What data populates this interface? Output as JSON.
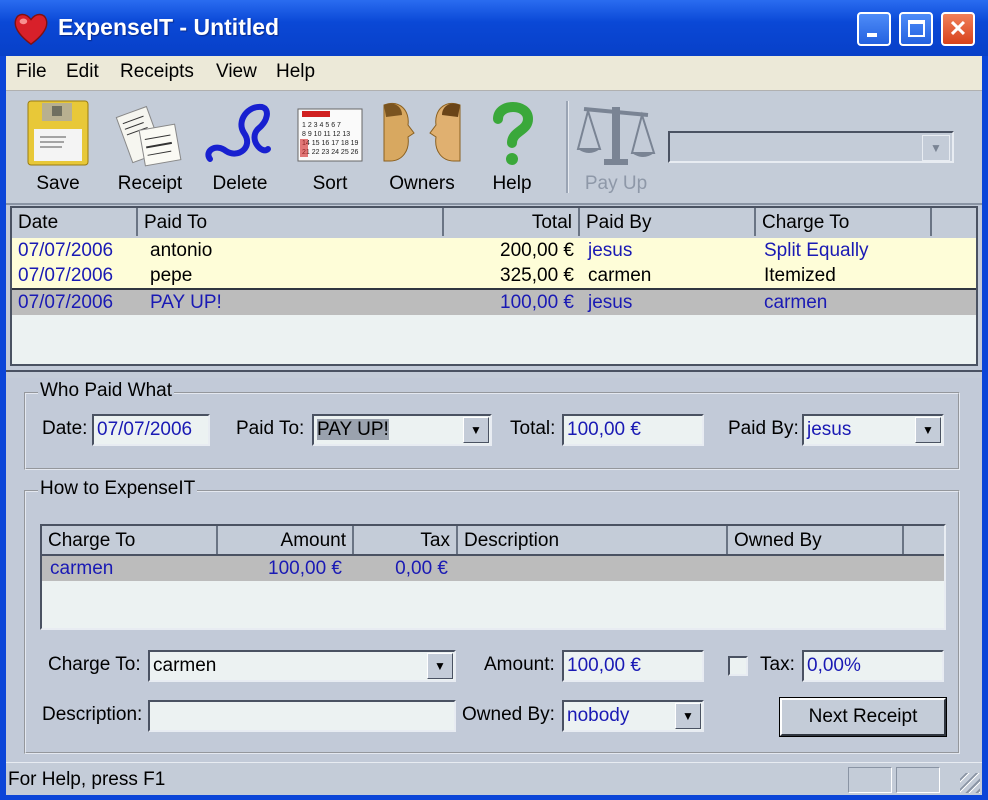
{
  "window": {
    "title": "ExpenseIT - Untitled",
    "icon": "heart-icon",
    "controls": [
      "minimize",
      "maximize",
      "close"
    ]
  },
  "menu": {
    "items": [
      "File",
      "Edit",
      "Receipts",
      "View",
      "Help"
    ]
  },
  "toolbar": {
    "buttons": [
      {
        "label": "Save",
        "icon": "floppy-disk-icon"
      },
      {
        "label": "Receipt",
        "icon": "receipt-icon"
      },
      {
        "label": "Delete",
        "icon": "scribble-delete-icon"
      },
      {
        "label": "Sort",
        "icon": "calendar-icon"
      },
      {
        "label": "Owners",
        "icon": "faces-icon"
      },
      {
        "label": "Help",
        "icon": "question-mark-icon"
      },
      {
        "label": "Pay Up",
        "icon": "balance-scale-icon",
        "disabled": true
      }
    ],
    "payup_combo_value": ""
  },
  "receipts": {
    "columns": [
      "Date",
      "Paid To",
      "Total",
      "Paid By",
      "Charge To"
    ],
    "rows": [
      {
        "date": "07/07/2006",
        "paid_to": "antonio",
        "total": "200,00 €",
        "paid_by": "jesus",
        "charge_to": "Split Equally"
      },
      {
        "date": "07/07/2006",
        "paid_to": "pepe",
        "total": "325,00 €",
        "paid_by": "carmen",
        "charge_to": "Itemized"
      },
      {
        "date": "07/07/2006",
        "paid_to": "PAY UP!",
        "total": "100,00 €",
        "paid_by": "jesus",
        "charge_to": "carmen",
        "selected": true
      }
    ]
  },
  "who_paid": {
    "legend": "Who Paid What",
    "date_label": "Date:",
    "date_value": "07/07/2006",
    "paid_to_label": "Paid To:",
    "paid_to_value": "PAY UP!",
    "total_label": "Total:",
    "total_value": "100,00 €",
    "paid_by_label": "Paid By:",
    "paid_by_value": "jesus"
  },
  "how_to": {
    "legend": "How to ExpenseIT",
    "columns": [
      "Charge To",
      "Amount",
      "Tax",
      "Description",
      "Owned By"
    ],
    "rows": [
      {
        "charge_to": "carmen",
        "amount": "100,00 €",
        "tax": "0,00 €",
        "description": "",
        "owned_by": ""
      }
    ],
    "charge_to_label": "Charge To:",
    "charge_to_value": "carmen",
    "amount_label": "Amount:",
    "amount_value": "100,00 €",
    "tax_label": "Tax:",
    "tax_value": "0,00%",
    "tax_checked": false,
    "description_label": "Description:",
    "description_value": "",
    "owned_by_label": "Owned By:",
    "owned_by_value": "nobody",
    "next_button": "Next Receipt"
  },
  "status": {
    "text": "For Help, press F1"
  },
  "colors": {
    "titlebar": "#0a48d6",
    "row_highlight": "#fefdd8",
    "row_selected": "#bcbcbc",
    "link_blue": "#1a1ab4"
  }
}
